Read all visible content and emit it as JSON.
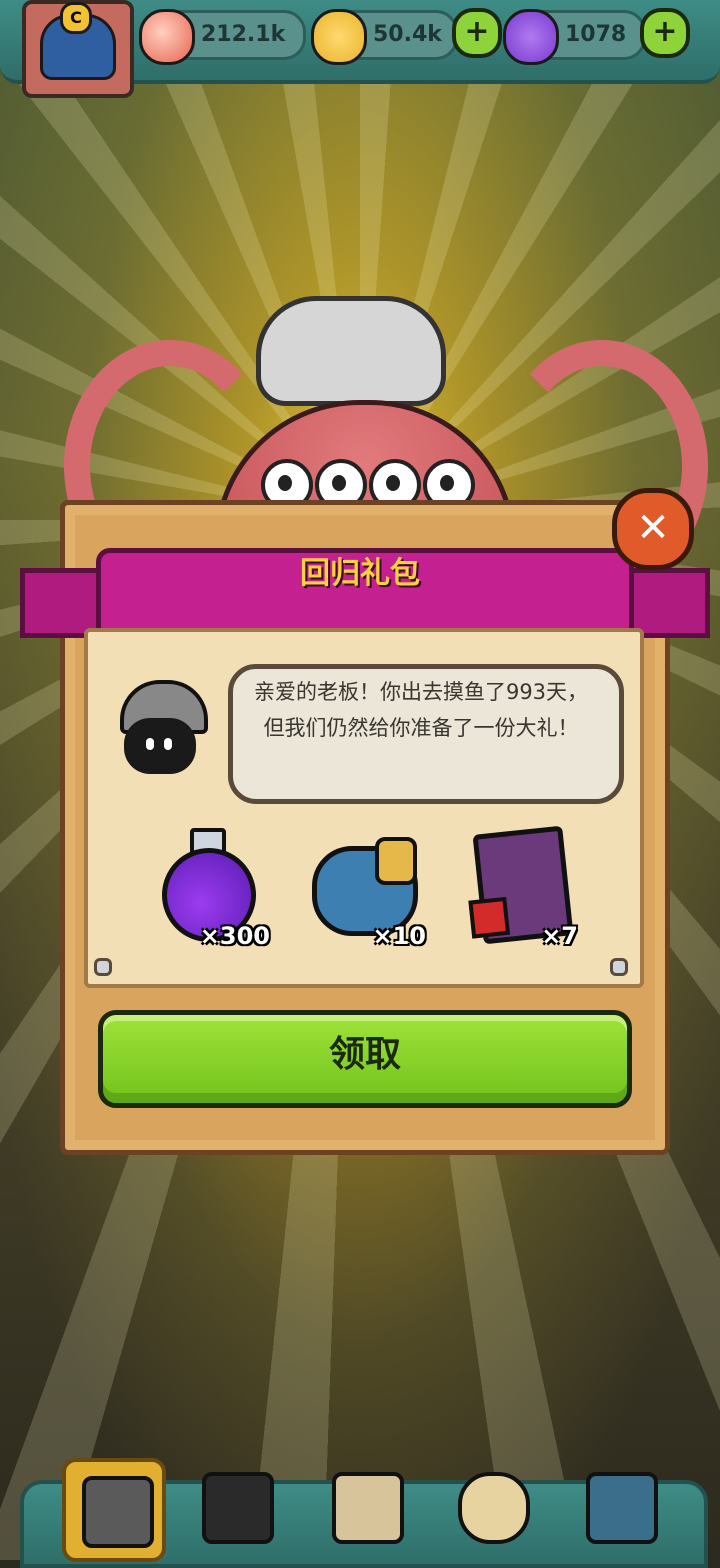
{
  "resources": {
    "eyeballs": {
      "value": "212.1k",
      "icon": "eyeball-icon",
      "color": "#e8644f"
    },
    "coins": {
      "value": "50.4k",
      "icon": "coin-icon",
      "color": "#e9b42a"
    },
    "potion": {
      "value": "1078",
      "icon": "potion-icon",
      "color": "#7a3ad0"
    },
    "plus_label": "+"
  },
  "player_badge": "C",
  "dialog": {
    "title": "回归礼包",
    "close_label": "✕",
    "message": "亲爱的老板！你出去摸鱼了993天，但我们仍然给你准备了一份大礼！",
    "rewards": [
      {
        "icon": "purple-potion-icon",
        "qty": "×300"
      },
      {
        "icon": "coin-stack-icon",
        "qty": "×10"
      },
      {
        "icon": "card-pack-icon",
        "qty": "×7"
      }
    ],
    "claim_label": "领取"
  },
  "bottom_nav": [
    {
      "icon": "shop-building-icon",
      "active": true
    },
    {
      "icon": "monster-crew-icon",
      "active": false
    },
    {
      "icon": "recipe-book-icon",
      "active": false
    },
    {
      "icon": "money-bag-icon",
      "active": false
    },
    {
      "icon": "grid-menu-icon",
      "active": false
    }
  ],
  "colors": {
    "accent_green": "#8fd33a",
    "ribbon_magenta": "#c4208f",
    "title_gold": "#ffd23a"
  }
}
